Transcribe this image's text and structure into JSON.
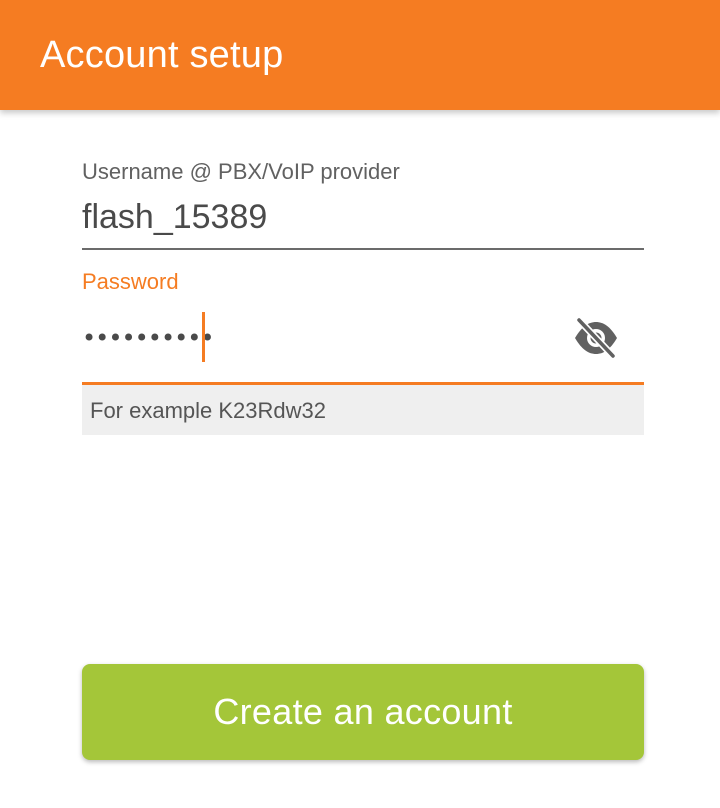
{
  "appbar": {
    "title": "Account setup",
    "color": "#f57c22"
  },
  "form": {
    "username": {
      "label": "Username @ PBX/VoIP provider",
      "value": "flash_15389"
    },
    "password": {
      "label": "Password",
      "masked_value": "••••••••••",
      "toggle_icon": "eye-off-icon",
      "hint": "For example K23Rdw32"
    }
  },
  "actions": {
    "create_label": "Create an account",
    "create_color": "#a4c639"
  }
}
